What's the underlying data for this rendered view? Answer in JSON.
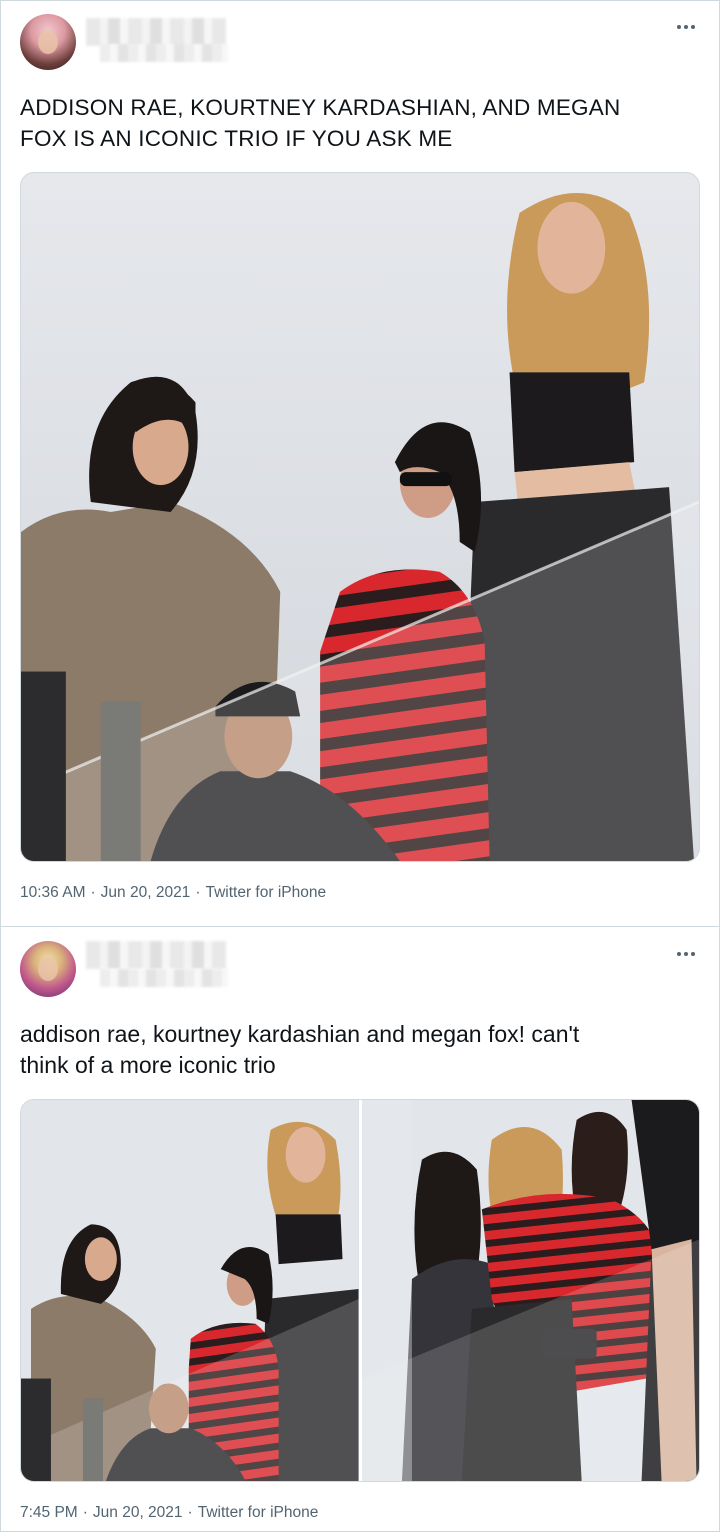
{
  "tweets": [
    {
      "text": "ADDISON RAE, KOURTNEY KARDASHIAN, AND MEGAN\nFOX IS AN ICONIC TRIO IF YOU ASK ME",
      "time": "10:36 AM",
      "date": "Jun 20, 2021",
      "source": "Twitter for iPhone",
      "separator": "·"
    },
    {
      "text": "addison rae, kourtney kardashian and megan fox! can't\nthink of a more iconic trio",
      "time": "7:45 PM",
      "date": "Jun 20, 2021",
      "source": "Twitter for iPhone",
      "separator": "·"
    }
  ],
  "icons": {
    "more": "more-horizontal-icon"
  },
  "colors": {
    "text": "#0f1419",
    "muted": "#536471",
    "border": "#cfd9de",
    "red": "#d8282d"
  }
}
